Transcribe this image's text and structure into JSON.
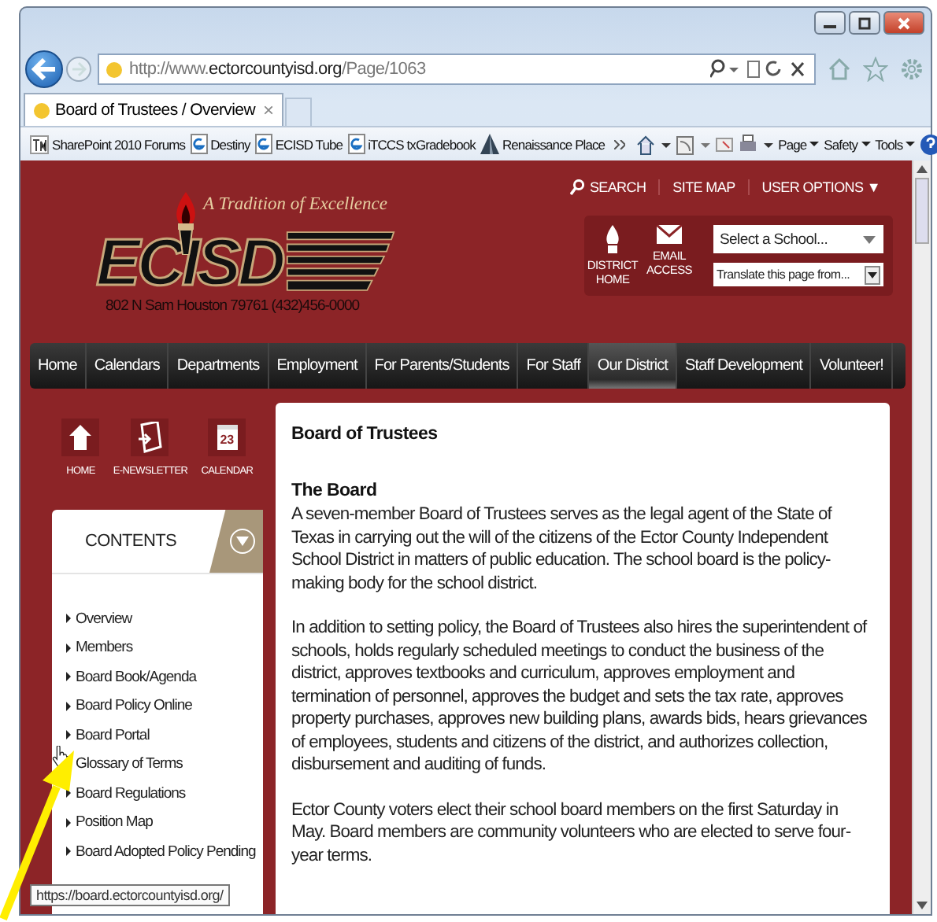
{
  "browser": {
    "address": {
      "prefix": "http://www.",
      "domain": "ectorcountyisd.org",
      "path": "/Page/1063"
    },
    "tab": {
      "title": "Board of Trustees / Overview",
      "close": "×"
    },
    "favorites": [
      {
        "label": "SharePoint 2010 Forums",
        "kind": "tn"
      },
      {
        "label": "Destiny",
        "kind": "page"
      },
      {
        "label": "ECISD Tube",
        "kind": "page"
      },
      {
        "label": "iTCCS txGradebook",
        "kind": "page"
      },
      {
        "label": "Renaissance Place",
        "kind": "ship"
      }
    ],
    "commands": [
      "Page",
      "Safety",
      "Tools"
    ]
  },
  "header": {
    "tagline": "A Tradition of Excellence",
    "logo": "ECISD",
    "address": "802 N Sam Houston 79761 (432)456-0000",
    "top_links": [
      "SEARCH",
      "SITE MAP",
      "USER OPTIONS ▼"
    ],
    "quick_links": [
      {
        "label": "DISTRICT HOME",
        "kind": "torch"
      },
      {
        "label": "EMAIL ACCESS",
        "kind": "mail"
      }
    ],
    "school_select": "Select a School...",
    "translate_select": "Translate this page from..."
  },
  "nav": [
    {
      "label": "Home",
      "selected": false
    },
    {
      "label": "Calendars",
      "selected": false
    },
    {
      "label": "Departments",
      "selected": false
    },
    {
      "label": "Employment",
      "selected": false
    },
    {
      "label": "For Parents/Students",
      "selected": false
    },
    {
      "label": "For Staff",
      "selected": false
    },
    {
      "label": "Our District",
      "selected": true
    },
    {
      "label": "Staff Development",
      "selected": false
    },
    {
      "label": "Volunteer!",
      "selected": false
    }
  ],
  "quick_icons": [
    {
      "label": "HOME",
      "kind": "home"
    },
    {
      "label": "E-NEWSLETTER",
      "kind": "newsletter"
    },
    {
      "label": "CALENDAR",
      "kind": "calendar",
      "day": "23"
    }
  ],
  "contents": {
    "title": "CONTENTS",
    "items": [
      "Overview",
      "Members",
      "Board Book/Agenda",
      "Board Policy Online",
      "Board Portal",
      "Glossary of Terms",
      "Board Regulations",
      "Position Map",
      "Board Adopted Policy Pending"
    ]
  },
  "article": {
    "title": "Board of Trustees",
    "heading": "The Board",
    "paragraphs": [
      "A seven-member Board of Trustees serves as the legal agent of the State of Texas in carrying out the will of the citizens of the Ector County Independent School District in matters of public education. The school board is the policy-making body for the school district.",
      "In addition to setting policy, the Board of Trustees also hires the superintendent of schools, holds regularly scheduled meetings to conduct the business of the district, approves textbooks and curriculum, approves employment and termination of personnel, approves the budget and sets the tax rate, approves property purchases, approves new building plans, awards bids, hears grievances of employees, students and citizens of the district, and authorizes collection, disbursement and auditing of funds.",
      "Ector County voters elect their school board members on the first Saturday in May. Board members are community volunteers who are elected to serve four-year terms."
    ]
  },
  "status_tooltip": "https://board.ectorcountyisd.org/"
}
